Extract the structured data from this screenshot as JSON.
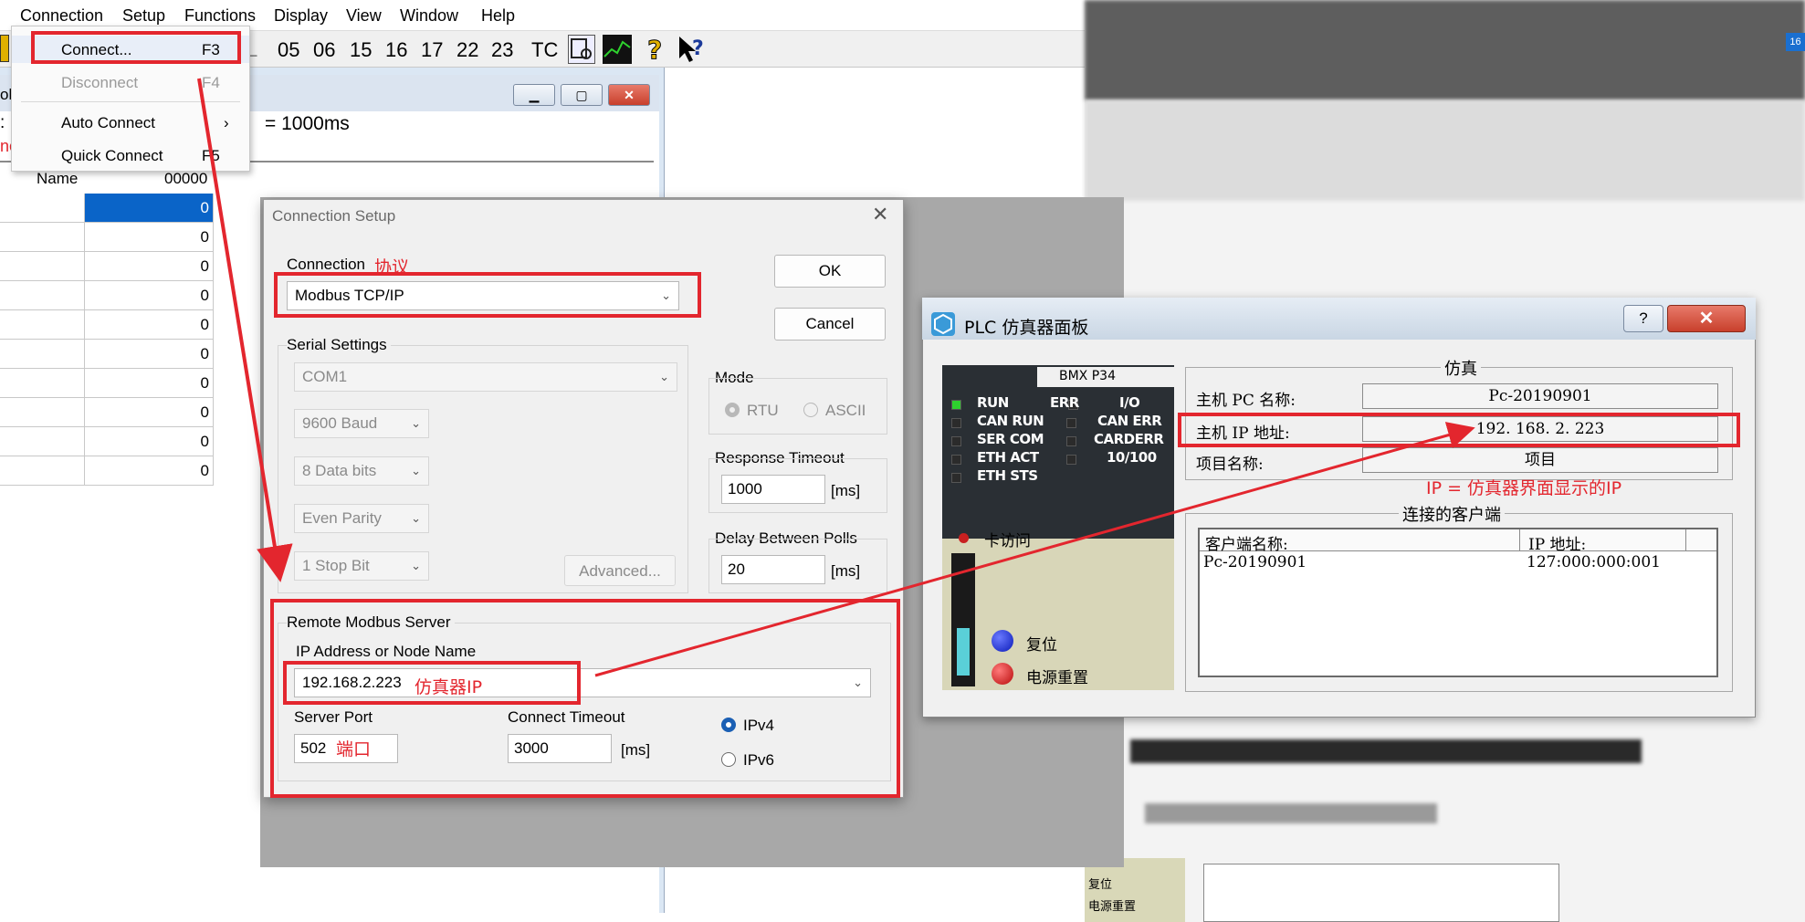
{
  "menubar": {
    "items": [
      "Connection",
      "Setup",
      "Functions",
      "Display",
      "View",
      "Window",
      "Help"
    ]
  },
  "toolbar": {
    "nums": [
      "05",
      "06",
      "15",
      "16",
      "17",
      "22",
      "23"
    ],
    "tc": "TC",
    "l_label": "L"
  },
  "dropdown": {
    "connect": {
      "label": "Connect...",
      "key": "F3"
    },
    "disconnect": {
      "label": "Disconnect",
      "key": "F4"
    },
    "auto_connect": {
      "label": "Auto Connect",
      "arrow": "›"
    },
    "quick_connect": {
      "label": "Quick Connect",
      "key": "F5"
    }
  },
  "poll_window": {
    "title_fragment": "oll",
    "scan_rate": "= 1000ms",
    "left_glyph": ":",
    "left_red": "ne",
    "col_name": "Name",
    "col_addr": "00000",
    "values": [
      "0",
      "0",
      "0",
      "0",
      "0",
      "0",
      "0",
      "0",
      "0",
      "0"
    ]
  },
  "dialog": {
    "title": "Connection Setup",
    "connection_label": "Connection",
    "connection_value": "Modbus TCP/IP",
    "serial_settings": "Serial Settings",
    "com": "COM1",
    "baud": "9600 Baud",
    "data_bits": "8 Data bits",
    "parity": "Even Parity",
    "stop_bit": "1 Stop Bit",
    "advanced": "Advanced...",
    "mode_label": "Mode",
    "rtu": "RTU",
    "ascii": "ASCII",
    "response_timeout": "Response Timeout",
    "response_value": "1000",
    "delay_polls": "Delay Between Polls",
    "delay_value": "20",
    "ms": "[ms]",
    "ok": "OK",
    "cancel": "Cancel",
    "remote_server": "Remote Modbus Server",
    "ip_label": "IP Address or Node Name",
    "ip_value": "192.168.2.223",
    "server_port": "Server Port",
    "port_value": "502",
    "connect_timeout": "Connect Timeout",
    "connect_timeout_value": "3000",
    "ipv4": "IPv4",
    "ipv6": "IPv6"
  },
  "annotations": {
    "protocol": "协议",
    "sim_ip": "仿真器IP",
    "port": "端口",
    "ip_note": "IP = 仿真器界面显示的IP"
  },
  "plc_panel": {
    "title": "PLC 仿真器面板",
    "help": "?",
    "model": "BMX P34",
    "leds_left": [
      "RUN",
      "CAN RUN",
      "SER COM",
      "ETH ACT",
      "ETH STS"
    ],
    "leds_mid": [
      "ERR",
      "CAN ERR",
      "CARDERR",
      "10/100"
    ],
    "io": "I/O",
    "card_access": "卡访问",
    "reset": "复位",
    "power_reset": "电源重置",
    "sim_group": "仿真",
    "host_pc_label": "主机 PC 名称:",
    "host_pc_value": "Pc-20190901",
    "host_ip_label": "主机 IP 地址:",
    "host_ip_value": "192. 168. 2. 223",
    "project_label": "项目名称:",
    "project_value": "项目",
    "clients_group": "连接的客户端",
    "client_col": "客户端名称:",
    "ip_col": "IP 地址:",
    "client_name": "Pc-20190901",
    "client_ip": "127:000:000:001"
  },
  "background_window": {
    "reset": "复位",
    "power_reset": "电源重置",
    "badge": "16"
  },
  "colors": {
    "accent_red": "#e3262e",
    "select_blue": "#0a64c8",
    "plc_green": "#2ed12e"
  }
}
